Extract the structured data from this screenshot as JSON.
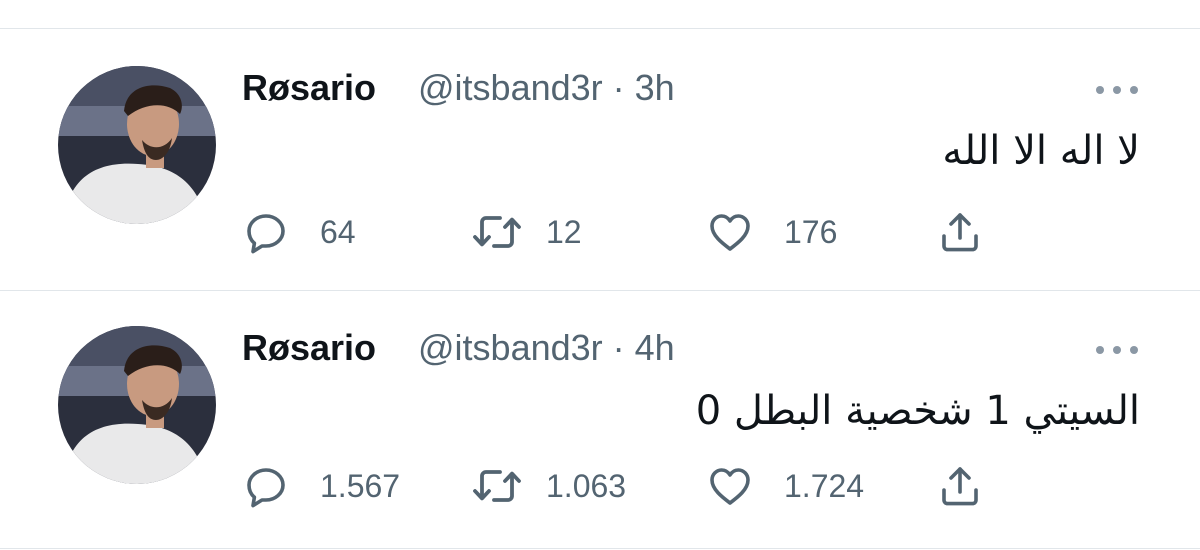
{
  "tweets": [
    {
      "display_name": "Røsario",
      "handle": "@itsband3r",
      "separator": "·",
      "time": "3h",
      "text": "لا اله الا الله",
      "replies": "64",
      "retweets": "12",
      "likes": "176"
    },
    {
      "display_name": "Røsario",
      "handle": "@itsband3r",
      "separator": "·",
      "time": "4h",
      "text": "السيتي 1 شخصية البطل 0",
      "replies": "1.567",
      "retweets": "1.063",
      "likes": "1.724"
    }
  ],
  "icons": {
    "reply": "speech-bubble",
    "retweet": "retweet-arrows",
    "like": "heart",
    "share": "share-upload",
    "more": "three-dots"
  },
  "colors": {
    "text": "#0f1419",
    "secondary": "#536471",
    "divider": "#e1e6ea"
  }
}
